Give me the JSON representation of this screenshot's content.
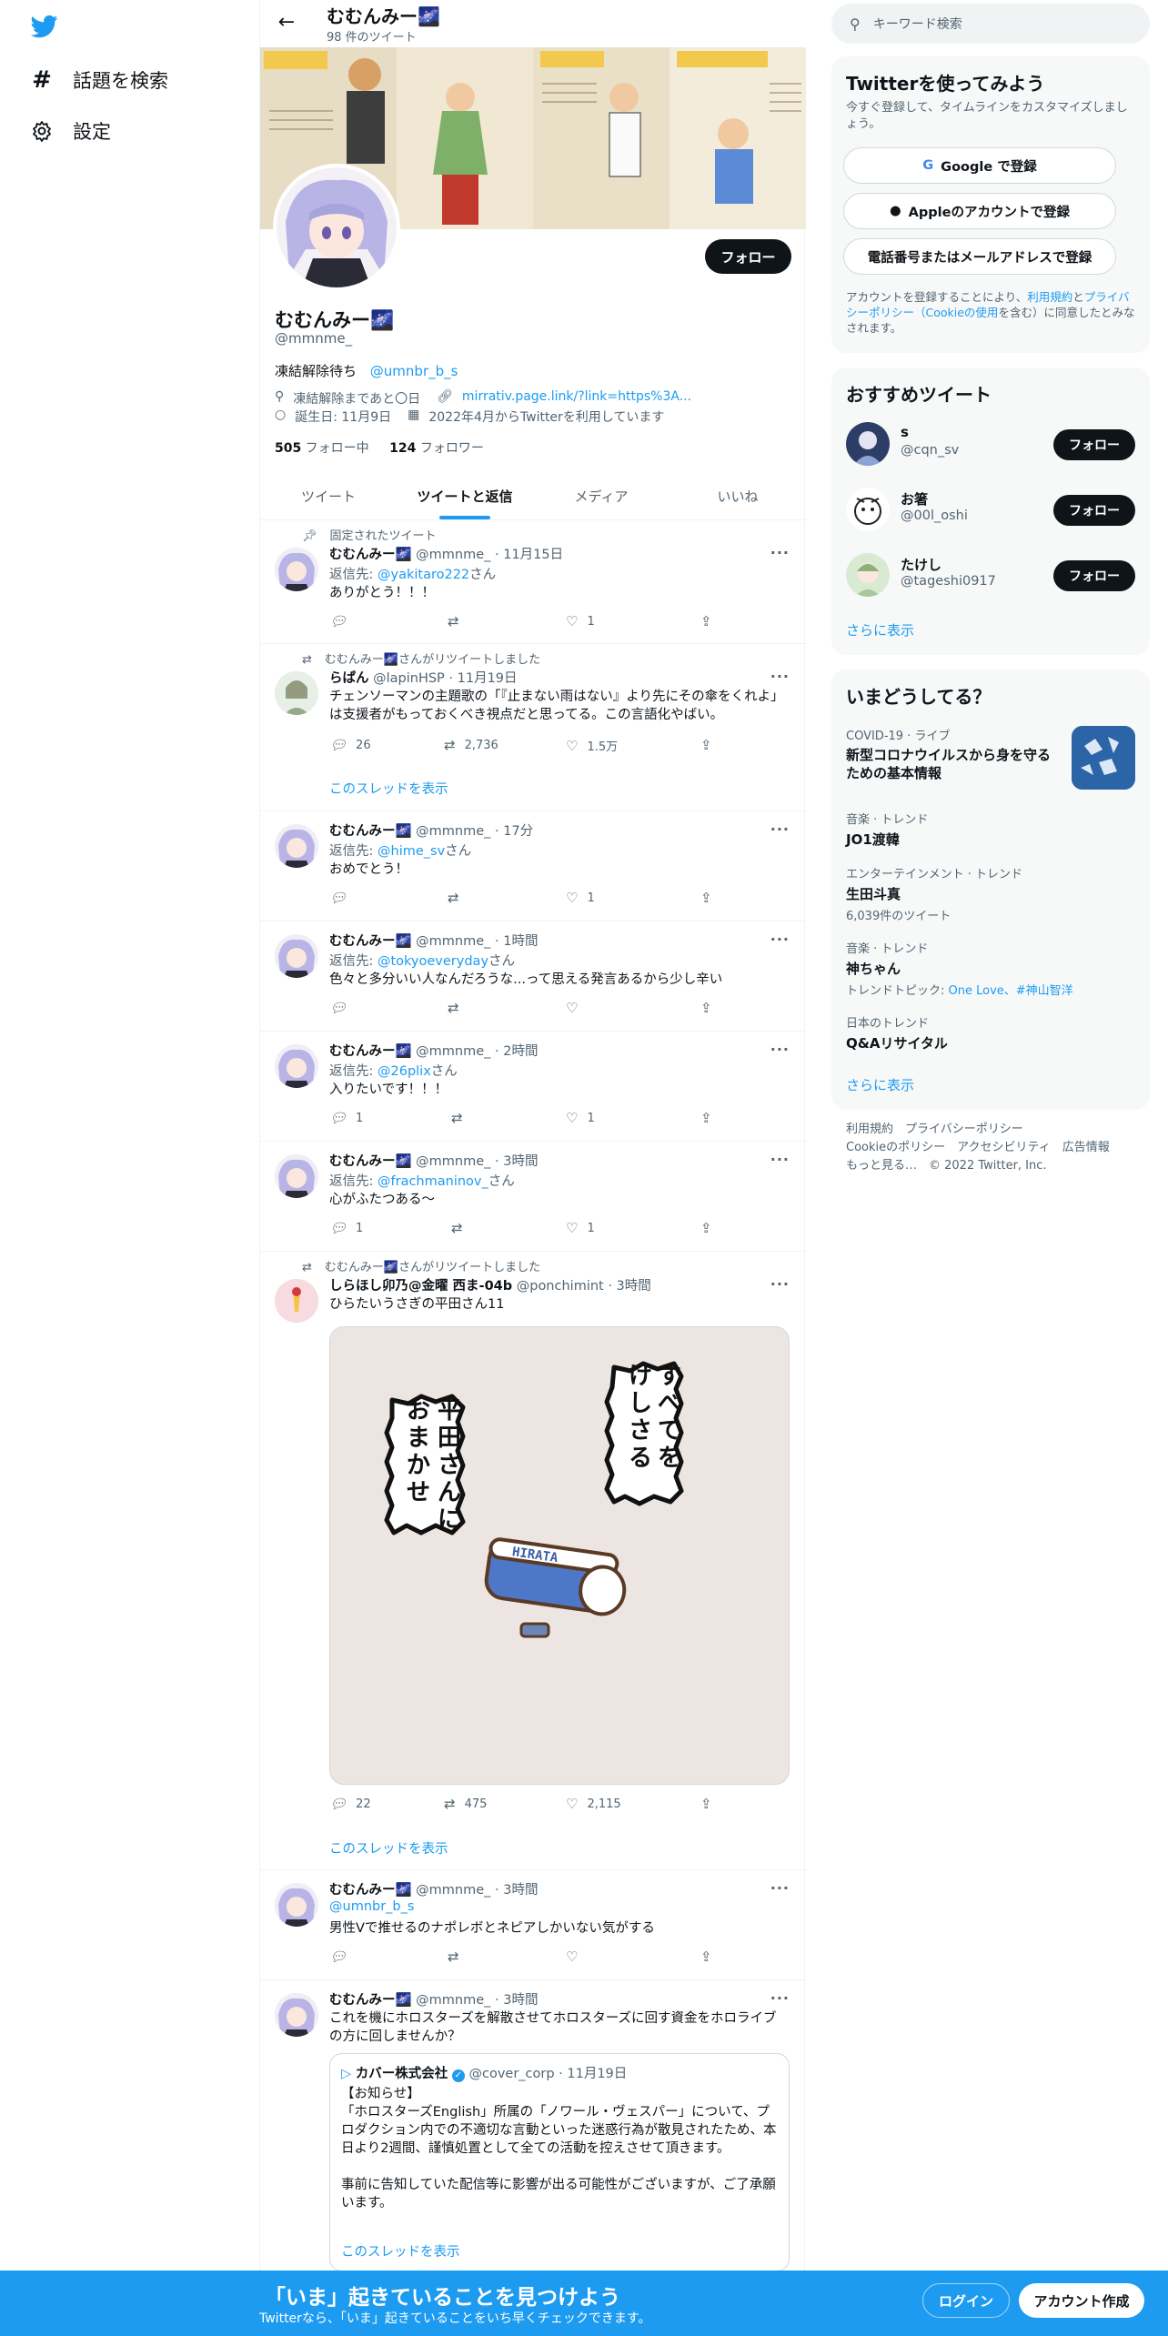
{
  "nav": {
    "explore": "話題を検索",
    "settings": "設定"
  },
  "header": {
    "name": "むむんみー🌌",
    "count": "98 件のツイート"
  },
  "profile": {
    "follow": "フォロー",
    "name": "むむんみー🌌",
    "handle": "@mmnme_",
    "bio_text": "凍結解除待ち",
    "bio_link": "@umnbr_b_s",
    "location": "凍結解除まであと〇日",
    "url": "mirrativ.page.link/?link=https%3A...",
    "birthday": "誕生日: 11月9日",
    "joined": "2022年4月からTwitterを利用しています",
    "following_count": "505",
    "following_label": " フォロー中",
    "followers_count": "124",
    "followers_label": " フォロワー"
  },
  "tabs": [
    "ツイート",
    "ツイートと返信",
    "メディア",
    "いいね"
  ],
  "tweets": [
    {
      "ctx": "固定されたツイート",
      "name": "むむんみー🌌",
      "meta": " @mmnme_ · 11月15日",
      "reply_prefix": "返信先: ",
      "reply_to": "@yakitaro222",
      "reply_suffix": "さん",
      "text": "ありがとう！！！",
      "replies": "",
      "rts": "",
      "likes": "1"
    },
    {
      "ctx": "むむんみー🌌さんがリツイートしました",
      "name": "らぱん",
      "meta": " @lapinHSP · 11月19日",
      "text": "チェンソーマンの主題歌の「『止まない雨はない』より先にその傘をくれよ」は支援者がもっておくべき視点だと思ってる。この言語化やばい。",
      "replies": "26",
      "rts": "2,736",
      "likes": "1.5万",
      "thread": "このスレッドを表示"
    },
    {
      "name": "むむんみー🌌",
      "meta": " @mmnme_ · 17分",
      "reply_prefix": "返信先: ",
      "reply_to": "@hime_sv",
      "reply_suffix": "さん",
      "text": "おめでとう！",
      "replies": "",
      "rts": "",
      "likes": "1"
    },
    {
      "name": "むむんみー🌌",
      "meta": " @mmnme_ · 1時間",
      "reply_prefix": "返信先: ",
      "reply_to": "@tokyoeveryday",
      "reply_suffix": "さん",
      "text": "色々と多分いい人なんだろうな...って思える発言あるから少し辛い",
      "replies": "",
      "rts": "",
      "likes": ""
    },
    {
      "name": "むむんみー🌌",
      "meta": " @mmnme_ · 2時間",
      "reply_prefix": "返信先: ",
      "reply_to": "@26plix",
      "reply_suffix": "さん",
      "text": "入りたいです！！！",
      "replies": "1",
      "rts": "",
      "likes": "1"
    },
    {
      "name": "むむんみー🌌",
      "meta": " @mmnme_ · 3時間",
      "reply_prefix": "返信先: ",
      "reply_to": "@frachmaninov_",
      "reply_suffix": "さん",
      "text": "心がふたつある〜",
      "replies": "1",
      "rts": "",
      "likes": "1"
    },
    {
      "ctx": "むむんみー🌌さんがリツイートしました",
      "name": "しらほし卯乃@金曜 西ま-04b",
      "meta": " @ponchimint · 3時間",
      "text": "ひらたいうさぎの平田さん11",
      "replies": "22",
      "rts": "475",
      "likes": "2,115",
      "thread": "このスレッドを表示",
      "img_bubble1": "すべてをけしさる",
      "img_bubble2": "平田さんにおまかせ",
      "img_label": "HIRATA"
    },
    {
      "name": "むむんみー🌌",
      "meta": " @mmnme_ · 3時間",
      "mention": "@umnbr_b_s",
      "text": "男性Vで推せるのナポレボとネピアしかいない気がする",
      "replies": "",
      "rts": "",
      "likes": ""
    },
    {
      "name": "むむんみー🌌",
      "meta": " @mmnme_ · 3時間",
      "text": "これを機にホロスターズを解散させてホロスターズに回す資金をホロライブの方に回しませんか？",
      "quote_name": "カバー株式会社",
      "quote_meta": " @cover_corp · 11月19日",
      "quote_text": "【お知らせ】\n「ホロスターズEnglish」所属の「ノワール・ヴェスパー」について、プロダクション内での不適切な言動といった迷惑行為が散見されたため、本日より2週間、謹慎処置として全ての活動を控えさせて頂きます。\n\n事前に告知していた配信等に影響が出る可能性がございますが、ご了承願います。",
      "quote_thread": "このスレッドを表示"
    }
  ],
  "search": {
    "placeholder": "キーワード検索"
  },
  "signup": {
    "title": "Twitterを使ってみよう",
    "desc": "今すぐ登録して、タイムラインをカスタマイズしましょう。",
    "google": "Google で登録",
    "apple": "Appleのアカウントで登録",
    "phone": "電話番号またはメールアドレスで登録",
    "legal_1": "アカウントを登録することにより、",
    "legal_link1": "利用規約",
    "legal_2": "と",
    "legal_link2": "プライバシーポリシー（Cookieの使用",
    "legal_3": "を含む）に同意したとみなされます。"
  },
  "suggest": {
    "title": "おすすめツイート",
    "users": [
      {
        "name": "s",
        "handle": "@cqn_sv"
      },
      {
        "name": "お箸",
        "handle": "@00l_oshi"
      },
      {
        "name": "たけし",
        "handle": "@tageshi0917"
      }
    ],
    "follow": "フォロー",
    "more": "さらに表示"
  },
  "trends": {
    "title": "いまどうしてる？",
    "items": [
      {
        "cat": "COVID-19 · ライブ",
        "title": "新型コロナウイルスから身を守るための基本情報",
        "sub": ""
      },
      {
        "cat": "音楽 · トレンド",
        "title": "JO1渡韓",
        "sub": ""
      },
      {
        "cat": "エンターテインメント · トレンド",
        "title": "生田斗真",
        "sub": "6,039件のツイート"
      },
      {
        "cat": "音楽 · トレンド",
        "title": "神ちゃん",
        "sub_prefix": "トレンドトピック: ",
        "sub_link": "One Love、#神山智洋"
      },
      {
        "cat": "日本のトレンド",
        "title": "Q&Aリサイタル",
        "sub": ""
      }
    ],
    "more": "さらに表示"
  },
  "footer": {
    "line1": "利用規約　プライバシーポリシー",
    "line2": "Cookieのポリシー　アクセシビリティ　広告情報",
    "line3": "もっと見る…　© 2022 Twitter, Inc."
  },
  "bottom": {
    "title": "「いま」起きていることを見つけよう",
    "sub": "Twitterなら、「いま」起きていることをいち早くチェックできます。",
    "login": "ログイン",
    "signup": "アカウント作成"
  },
  "colors": {
    "accent": "#1d9bf0",
    "text": "#0f1419",
    "muted": "#536471"
  }
}
